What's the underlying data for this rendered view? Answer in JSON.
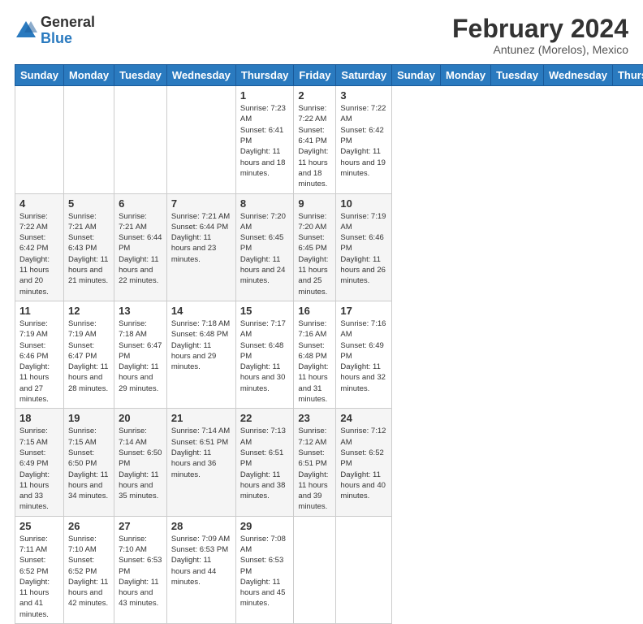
{
  "logo": {
    "general": "General",
    "blue": "Blue"
  },
  "header": {
    "title": "February 2024",
    "subtitle": "Antunez (Morelos), Mexico"
  },
  "weekdays": [
    "Sunday",
    "Monday",
    "Tuesday",
    "Wednesday",
    "Thursday",
    "Friday",
    "Saturday"
  ],
  "weeks": [
    [
      {
        "day": "",
        "info": ""
      },
      {
        "day": "",
        "info": ""
      },
      {
        "day": "",
        "info": ""
      },
      {
        "day": "",
        "info": ""
      },
      {
        "day": "1",
        "info": "Sunrise: 7:23 AM\nSunset: 6:41 PM\nDaylight: 11 hours and 18 minutes."
      },
      {
        "day": "2",
        "info": "Sunrise: 7:22 AM\nSunset: 6:41 PM\nDaylight: 11 hours and 18 minutes."
      },
      {
        "day": "3",
        "info": "Sunrise: 7:22 AM\nSunset: 6:42 PM\nDaylight: 11 hours and 19 minutes."
      }
    ],
    [
      {
        "day": "4",
        "info": "Sunrise: 7:22 AM\nSunset: 6:42 PM\nDaylight: 11 hours and 20 minutes."
      },
      {
        "day": "5",
        "info": "Sunrise: 7:21 AM\nSunset: 6:43 PM\nDaylight: 11 hours and 21 minutes."
      },
      {
        "day": "6",
        "info": "Sunrise: 7:21 AM\nSunset: 6:44 PM\nDaylight: 11 hours and 22 minutes."
      },
      {
        "day": "7",
        "info": "Sunrise: 7:21 AM\nSunset: 6:44 PM\nDaylight: 11 hours and 23 minutes."
      },
      {
        "day": "8",
        "info": "Sunrise: 7:20 AM\nSunset: 6:45 PM\nDaylight: 11 hours and 24 minutes."
      },
      {
        "day": "9",
        "info": "Sunrise: 7:20 AM\nSunset: 6:45 PM\nDaylight: 11 hours and 25 minutes."
      },
      {
        "day": "10",
        "info": "Sunrise: 7:19 AM\nSunset: 6:46 PM\nDaylight: 11 hours and 26 minutes."
      }
    ],
    [
      {
        "day": "11",
        "info": "Sunrise: 7:19 AM\nSunset: 6:46 PM\nDaylight: 11 hours and 27 minutes."
      },
      {
        "day": "12",
        "info": "Sunrise: 7:19 AM\nSunset: 6:47 PM\nDaylight: 11 hours and 28 minutes."
      },
      {
        "day": "13",
        "info": "Sunrise: 7:18 AM\nSunset: 6:47 PM\nDaylight: 11 hours and 29 minutes."
      },
      {
        "day": "14",
        "info": "Sunrise: 7:18 AM\nSunset: 6:48 PM\nDaylight: 11 hours and 29 minutes."
      },
      {
        "day": "15",
        "info": "Sunrise: 7:17 AM\nSunset: 6:48 PM\nDaylight: 11 hours and 30 minutes."
      },
      {
        "day": "16",
        "info": "Sunrise: 7:16 AM\nSunset: 6:48 PM\nDaylight: 11 hours and 31 minutes."
      },
      {
        "day": "17",
        "info": "Sunrise: 7:16 AM\nSunset: 6:49 PM\nDaylight: 11 hours and 32 minutes."
      }
    ],
    [
      {
        "day": "18",
        "info": "Sunrise: 7:15 AM\nSunset: 6:49 PM\nDaylight: 11 hours and 33 minutes."
      },
      {
        "day": "19",
        "info": "Sunrise: 7:15 AM\nSunset: 6:50 PM\nDaylight: 11 hours and 34 minutes."
      },
      {
        "day": "20",
        "info": "Sunrise: 7:14 AM\nSunset: 6:50 PM\nDaylight: 11 hours and 35 minutes."
      },
      {
        "day": "21",
        "info": "Sunrise: 7:14 AM\nSunset: 6:51 PM\nDaylight: 11 hours and 36 minutes."
      },
      {
        "day": "22",
        "info": "Sunrise: 7:13 AM\nSunset: 6:51 PM\nDaylight: 11 hours and 38 minutes."
      },
      {
        "day": "23",
        "info": "Sunrise: 7:12 AM\nSunset: 6:51 PM\nDaylight: 11 hours and 39 minutes."
      },
      {
        "day": "24",
        "info": "Sunrise: 7:12 AM\nSunset: 6:52 PM\nDaylight: 11 hours and 40 minutes."
      }
    ],
    [
      {
        "day": "25",
        "info": "Sunrise: 7:11 AM\nSunset: 6:52 PM\nDaylight: 11 hours and 41 minutes."
      },
      {
        "day": "26",
        "info": "Sunrise: 7:10 AM\nSunset: 6:52 PM\nDaylight: 11 hours and 42 minutes."
      },
      {
        "day": "27",
        "info": "Sunrise: 7:10 AM\nSunset: 6:53 PM\nDaylight: 11 hours and 43 minutes."
      },
      {
        "day": "28",
        "info": "Sunrise: 7:09 AM\nSunset: 6:53 PM\nDaylight: 11 hours and 44 minutes."
      },
      {
        "day": "29",
        "info": "Sunrise: 7:08 AM\nSunset: 6:53 PM\nDaylight: 11 hours and 45 minutes."
      },
      {
        "day": "",
        "info": ""
      },
      {
        "day": "",
        "info": ""
      }
    ]
  ]
}
